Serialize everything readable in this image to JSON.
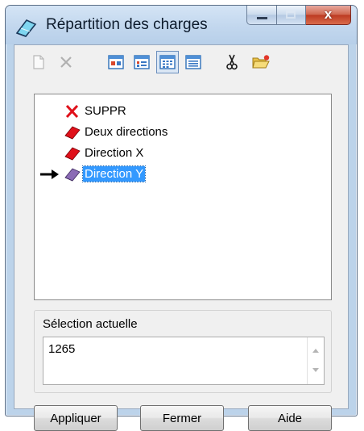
{
  "window": {
    "title": "Répartition des charges",
    "close_glyph": "x"
  },
  "toolbar": {
    "buttons": [
      {
        "name": "new-icon",
        "enabled": false
      },
      {
        "name": "delete-icon",
        "enabled": false
      },
      {
        "name": "large-icons-view-icon",
        "enabled": true
      },
      {
        "name": "small-icons-view-icon",
        "enabled": true
      },
      {
        "name": "list-view-icon",
        "enabled": true,
        "pressed": true
      },
      {
        "name": "details-view-icon",
        "enabled": true
      },
      {
        "name": "cut-icon",
        "enabled": true
      },
      {
        "name": "open-folder-icon",
        "enabled": true
      }
    ]
  },
  "tree": {
    "items": [
      {
        "label": "SUPPR",
        "icon": "red-x-icon"
      },
      {
        "label": "Deux directions",
        "icon": "red-eraser-icon"
      },
      {
        "label": "Direction X",
        "icon": "red-eraser-icon"
      },
      {
        "label": "Direction Y",
        "icon": "purple-eraser-icon",
        "selected": true,
        "current_marker": "arrow-right-icon"
      }
    ]
  },
  "selection": {
    "label": "Sélection actuelle",
    "value": "1265"
  },
  "buttons": {
    "apply": "Appliquer",
    "close": "Fermer",
    "help": "Aide"
  },
  "colors": {
    "selection_highlight": "#3399ff",
    "red_item": "#e0101a",
    "purple_item": "#8b6bb5",
    "close_button": "#c9452c"
  }
}
